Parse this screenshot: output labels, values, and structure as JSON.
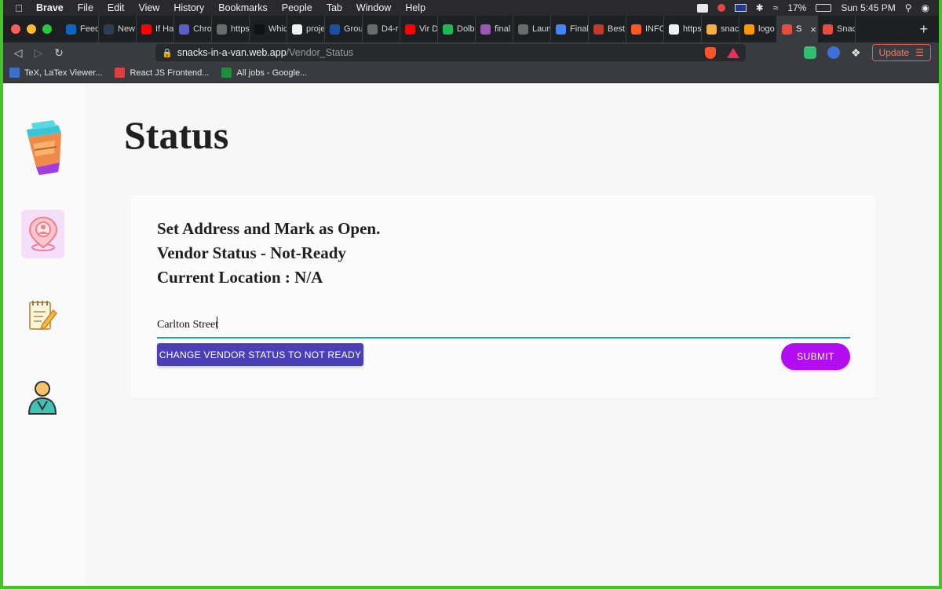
{
  "menubar": {
    "app_name": "Brave",
    "items": [
      "File",
      "Edit",
      "View",
      "History",
      "Bookmarks",
      "People",
      "Tab",
      "Window",
      "Help"
    ],
    "battery": "17%",
    "clock": "Sun 5:45 PM"
  },
  "tabs": [
    {
      "label": "Feed",
      "color": "#0a66c2"
    },
    {
      "label": "New",
      "color": "#2c3e50"
    },
    {
      "label": "If Ha",
      "color": "#ff0000"
    },
    {
      "label": "Chro",
      "color": "#5b5fc7"
    },
    {
      "label": "https",
      "color": "#6b6b6b"
    },
    {
      "label": "Whic",
      "color": "#111111"
    },
    {
      "label": "proje",
      "color": "#f0f0f0"
    },
    {
      "label": "Grou",
      "color": "#1a4fa3"
    },
    {
      "label": "D4-r",
      "color": "#6b6b6b"
    },
    {
      "label": "Vir D",
      "color": "#ff0000"
    },
    {
      "label": "Dolb",
      "color": "#1db954"
    },
    {
      "label": "final",
      "color": "#9b59b6"
    },
    {
      "label": "Laun",
      "color": "#6b6b6b"
    },
    {
      "label": "Final",
      "color": "#4285f4"
    },
    {
      "label": "Best",
      "color": "#c0392b"
    },
    {
      "label": "INFO",
      "color": "#ff5722"
    },
    {
      "label": "https",
      "color": "#f0f0f0"
    },
    {
      "label": "snac",
      "color": "#f5b041"
    },
    {
      "label": "logo",
      "color": "#ff9800"
    },
    {
      "label": "S",
      "color": "#e74c3c",
      "active": true
    },
    {
      "label": "Snac",
      "color": "#e74c3c"
    }
  ],
  "address_bar": {
    "host": "snacks-in-a-van.web.app",
    "path": "/Vendor_Status"
  },
  "toolbar": {
    "update_label": "Update"
  },
  "bookmarks": [
    {
      "label": "TeX, LaTex Viewer...",
      "color": "#3b6fc9"
    },
    {
      "label": "React JS Frontend...",
      "color": "#d94040"
    },
    {
      "label": "All jobs - Google...",
      "color": "#1e8e3e"
    }
  ],
  "page": {
    "title": "Status",
    "line1": "Set Address and Mark as Open.",
    "line2": "Vendor Status - Not-Ready",
    "line3": "Current Location : N/A",
    "address_value": "Carlton Street",
    "change_status_label": "CHANGE VENDOR STATUS TO NOT READY",
    "submit_label": "SUBMIT"
  },
  "sidebar_icons": [
    "coffee-cup-icon",
    "location-pin-icon",
    "notepad-icon",
    "user-profile-icon"
  ]
}
